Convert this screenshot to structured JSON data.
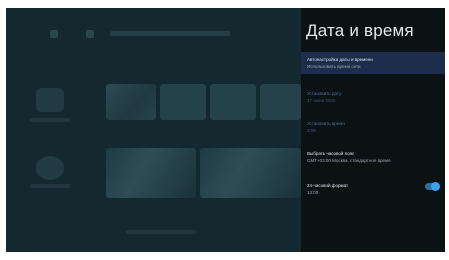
{
  "panel": {
    "title": "Дата и время",
    "items": [
      {
        "title": "Автонастройка даты и времени",
        "subtitle": "Использовать время сети",
        "state": "selected"
      },
      {
        "title": "Установить дату",
        "subtitle": "17 июня 2020",
        "state": "disabled"
      },
      {
        "title": "Установить время",
        "subtitle": "3:08",
        "state": "disabled"
      },
      {
        "title": "Выбрать часовой пояс",
        "subtitle": "GMT+03:00 Москва, стандартное время",
        "state": "normal"
      },
      {
        "title": "24-часовой формат",
        "subtitle": "13:00",
        "state": "normal",
        "toggle": true
      }
    ]
  },
  "colors": {
    "accent": "#3aa4e8",
    "selected_bg": "#1c2e4c",
    "panel_bg": "#0b1214"
  }
}
